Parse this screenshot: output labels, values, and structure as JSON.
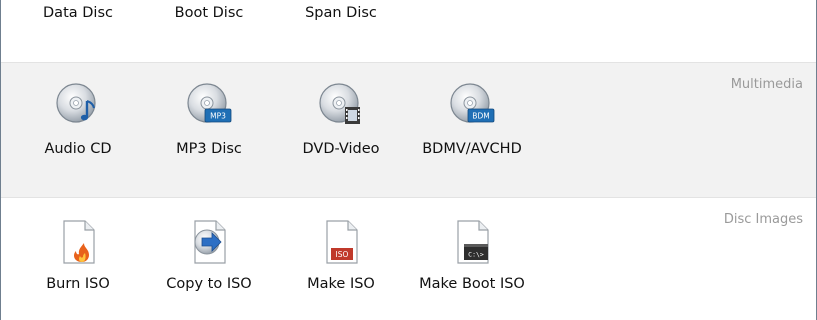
{
  "top": {
    "items": [
      {
        "label": "Data Disc"
      },
      {
        "label": "Boot Disc"
      },
      {
        "label": "Span Disc"
      }
    ]
  },
  "multimedia": {
    "section_label": "Multimedia",
    "items": [
      {
        "label": "Audio CD",
        "icon": "audio-cd-icon"
      },
      {
        "label": "MP3 Disc",
        "icon": "mp3-disc-icon",
        "badge": "MP3"
      },
      {
        "label": "DVD-Video",
        "icon": "dvd-video-icon"
      },
      {
        "label": "BDMV/AVCHD",
        "icon": "bdmv-icon",
        "badge": "BDM"
      }
    ]
  },
  "disc_images": {
    "section_label": "Disc Images",
    "items": [
      {
        "label": "Burn ISO",
        "icon": "burn-iso-icon"
      },
      {
        "label": "Copy to ISO",
        "icon": "copy-to-iso-icon"
      },
      {
        "label": "Make ISO",
        "icon": "make-iso-icon",
        "badge": "ISO"
      },
      {
        "label": "Make Boot ISO",
        "icon": "make-boot-iso-icon",
        "badge": "C:\\>"
      }
    ]
  },
  "colors": {
    "section_bg": "#f2f2f2",
    "section_label": "#9a9a9a",
    "badge_blue": "#1f6fb5",
    "badge_red": "#c0392b",
    "arrow_blue": "#2d6fc4",
    "flame": "#e8621c"
  }
}
